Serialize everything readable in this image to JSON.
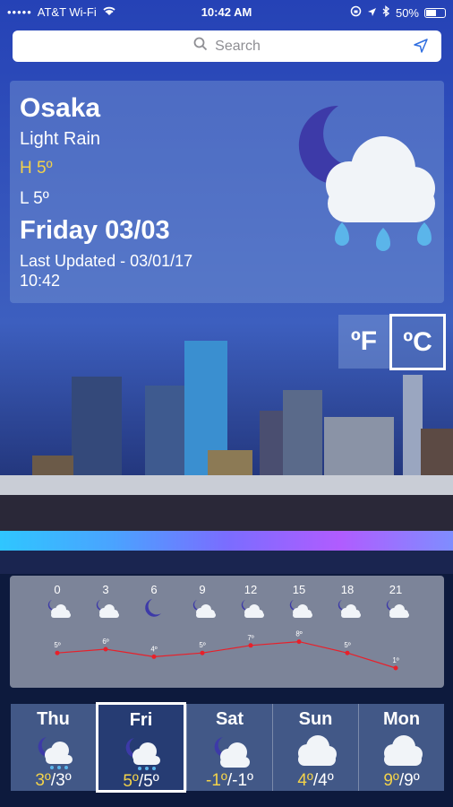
{
  "status_bar": {
    "carrier": "AT&T Wi-Fi",
    "time": "10:42 AM",
    "battery": "50%"
  },
  "search": {
    "placeholder": "Search",
    "icon": "search-icon",
    "location_icon": "location-arrow-icon"
  },
  "current": {
    "city": "Osaka",
    "condition": "Light Rain",
    "high": "H 5º",
    "low": "L 5º",
    "date": "Friday 03/03",
    "last_updated": "Last Updated - 03/01/17 10:42",
    "icon": "night-rain-icon"
  },
  "units": {
    "fahrenheit": "ºF",
    "celsius": "ºC",
    "selected": "celsius"
  },
  "hourly": {
    "hours": [
      "0",
      "3",
      "6",
      "9",
      "12",
      "15",
      "18",
      "21"
    ],
    "temps": [
      5,
      6,
      4,
      5,
      7,
      8,
      5,
      1
    ],
    "temp_labels": [
      "5º",
      "6º",
      "4º",
      "5º",
      "7º",
      "8º",
      "5º",
      "1º"
    ],
    "icons": [
      "night-cloud-icon",
      "night-cloud-icon",
      "moon-icon",
      "night-cloud-icon",
      "night-cloud-icon",
      "night-cloud-icon",
      "night-cloud-icon",
      "night-cloud-icon"
    ],
    "line_color": "#e8202a"
  },
  "daily": [
    {
      "day": "Thu",
      "high": "3º",
      "low": "3º",
      "icon": "night-rain-icon"
    },
    {
      "day": "Fri",
      "high": "5º",
      "low": "5º",
      "icon": "night-rain-icon",
      "selected": true
    },
    {
      "day": "Sat",
      "high": "-1º",
      "low": "-1º",
      "icon": "night-cloud-icon"
    },
    {
      "day": "Sun",
      "high": "4º",
      "low": "4º",
      "icon": "cloud-icon"
    },
    {
      "day": "Mon",
      "high": "9º",
      "low": "9º",
      "icon": "cloud-icon"
    }
  ],
  "colors": {
    "accent_high": "#f2d24a",
    "panel": "#7896d2"
  }
}
